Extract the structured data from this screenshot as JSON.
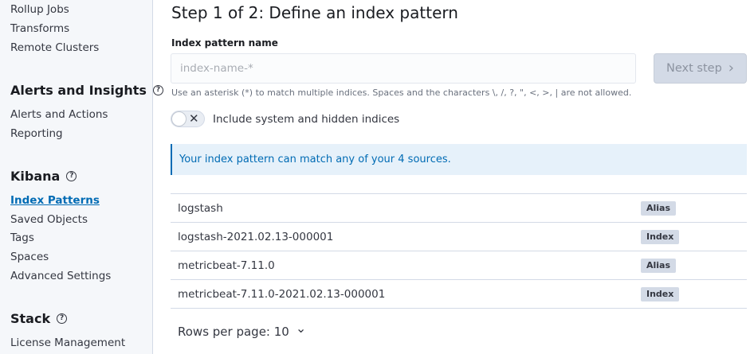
{
  "sidebar": {
    "top_items": [
      "Rollup Jobs",
      "Transforms",
      "Remote Clusters"
    ],
    "sections": [
      {
        "title": "Alerts and Insights",
        "items": [
          "Alerts and Actions",
          "Reporting"
        ]
      },
      {
        "title": "Kibana",
        "items": [
          "Index Patterns",
          "Saved Objects",
          "Tags",
          "Spaces",
          "Advanced Settings"
        ]
      },
      {
        "title": "Stack",
        "items": [
          "License Management"
        ]
      }
    ],
    "help_glyph": "?",
    "active_item": "Index Patterns"
  },
  "main": {
    "title": "Step 1 of 2: Define an index pattern",
    "field_label": "Index pattern name",
    "input": {
      "value": "",
      "placeholder": "index-name-*"
    },
    "next_button": {
      "label": "Next step",
      "icon": "›"
    },
    "help_text": "Use an asterisk (*) to match multiple indices. Spaces and the characters \\, /, ?, \", <, >, | are not allowed.",
    "toggle": {
      "label": "Include system and hidden indices",
      "checked": false,
      "icon": "✕"
    },
    "callout": "Your index pattern can match any of your 4 sources.",
    "sources": [
      {
        "name": "logstash",
        "type": "Alias"
      },
      {
        "name": "logstash-2021.02.13-000001",
        "type": "Index"
      },
      {
        "name": "metricbeat-7.11.0",
        "type": "Alias"
      },
      {
        "name": "metricbeat-7.11.0-2021.02.13-000001",
        "type": "Index"
      }
    ],
    "rows_per_page": {
      "label": "Rows per page: 10",
      "icon": "⌄"
    }
  },
  "colors": {
    "accent": "#006bb4",
    "sidebar_bg": "#f5f7fa",
    "callout_bg": "#e6f1fa",
    "badge_bg": "#d3dae6"
  }
}
